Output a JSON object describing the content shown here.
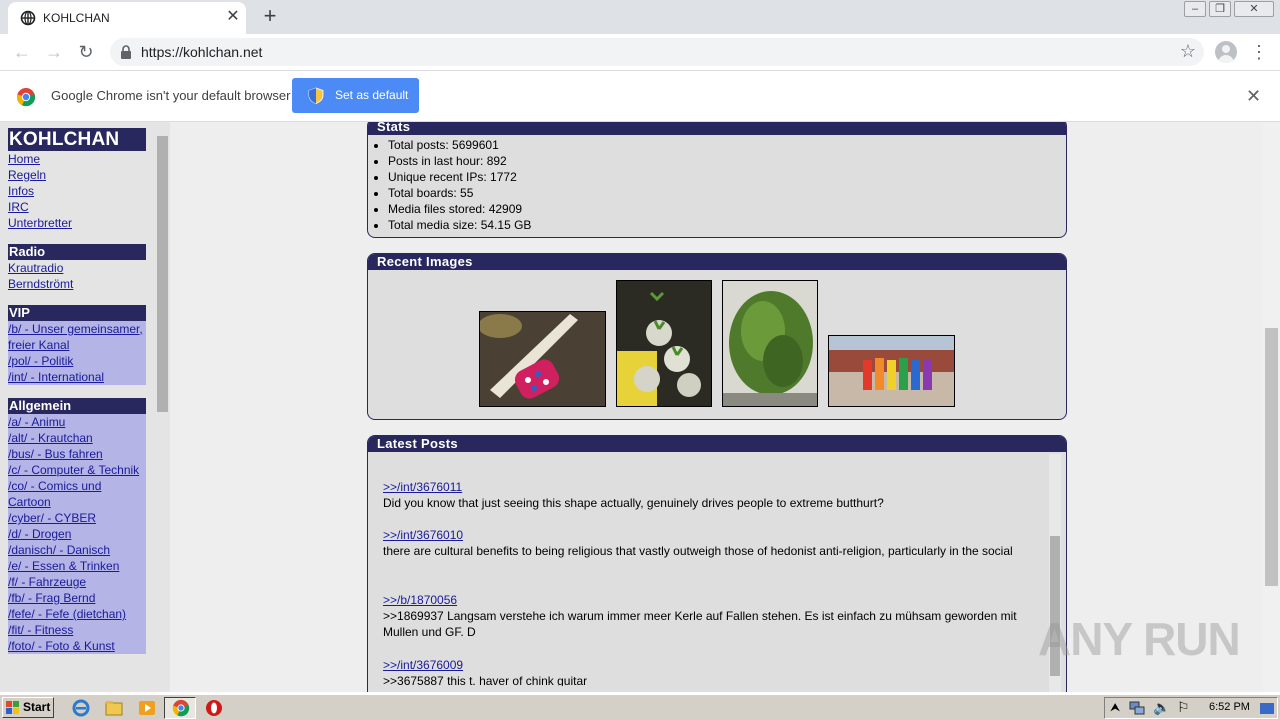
{
  "browser": {
    "tab_title": "KOHLCHAN",
    "url": "https://kohlchan.net",
    "infobar_message": "Google Chrome isn't your default browser",
    "set_default_label": "Set as default"
  },
  "nav": {
    "site_title": "KOHLCHAN",
    "main_links": [
      "Home",
      "Regeln",
      "Infos",
      "IRC",
      "Unterbretter"
    ],
    "sections": [
      {
        "title": "Radio",
        "links": [
          "Krautradio",
          "Berndströmt"
        ]
      },
      {
        "title": "VIP",
        "links": [
          "/b/ - Unser gemeinsamer, freier Kanal",
          "/pol/ - Politik",
          "/int/ - International"
        ]
      },
      {
        "title": "Allgemein",
        "links": [
          "/a/ - Animu",
          "/alt/ - Krautchan",
          "/bus/ - Bus fahren",
          "/c/ - Computer & Technik",
          "/co/ - Comics und Cartoon",
          "/cyber/ - CYBER",
          "/d/ - Drogen",
          "/danisch/ - Danisch",
          "/e/ - Essen & Trinken",
          "/f/ - Fahrzeuge",
          "/fb/ - Frag Bernd",
          "/fefe/ - Fefe (dietchan)",
          "/fit/ - Fitness",
          "/foto/ - Foto & Kunst"
        ]
      }
    ]
  },
  "stats": {
    "title": "Stats",
    "items": [
      "Total posts: 5699601",
      "Posts in last hour: 892",
      "Unique recent IPs: 1772",
      "Total boards: 55",
      "Media files stored: 42909",
      "Total media size: 54.15 GB"
    ]
  },
  "recent_images": {
    "title": "Recent Images"
  },
  "latest_posts": {
    "title": "Latest Posts",
    "posts": [
      {
        "link": ">>/int/3676011",
        "text": "Did you know that just seeing this shape actually, genuinely drives people to extreme butthurt?"
      },
      {
        "link": ">>/int/3676010",
        "text": "there are cultural benefits to being religious that vastly outweigh those of hedonist anti-religion, particularly in the social"
      },
      {
        "link": ">>/b/1870056",
        "text": ">>1869937 Langsam verstehe ich warum immer meer Kerle auf Fallen stehen. Es ist einfach zu mühsam geworden mit Mullen und GF. D"
      },
      {
        "link": ">>/int/3676009",
        "text": ">>3675887 this t. haver of chink guitar"
      }
    ]
  },
  "watermark": "ANY RUN",
  "taskbar": {
    "start_label": "Start",
    "clock": "6:52 PM"
  }
}
